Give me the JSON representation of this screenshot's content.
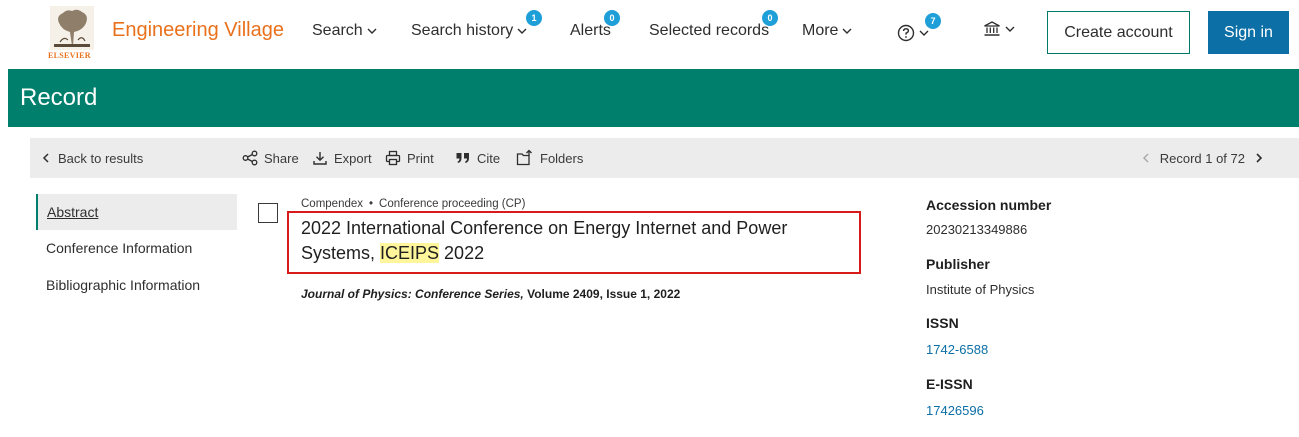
{
  "brand": {
    "logo_text": "ELSEVIER",
    "name": "Engineering Village"
  },
  "nav": {
    "search": "Search",
    "search_history": "Search history",
    "search_history_count": "1",
    "alerts": "Alerts",
    "alerts_count": "0",
    "selected_records": "Selected records",
    "selected_records_count": "0",
    "more": "More",
    "help_count": "7",
    "create_account": "Create account",
    "sign_in": "Sign in"
  },
  "header": {
    "title": "Record"
  },
  "toolbar": {
    "back": "Back to results",
    "share": "Share",
    "export": "Export",
    "print": "Print",
    "cite": "Cite",
    "folders": "Folders",
    "record_position": "Record 1 of 72"
  },
  "leftnav": {
    "items": [
      "Abstract",
      "Conference Information",
      "Bibliographic Information"
    ],
    "active": "Abstract"
  },
  "record": {
    "database": "Compendex",
    "doc_type": "Conference proceeding (CP)",
    "title_before": "2022 International Conference on Energy Internet and Power Systems, ",
    "title_highlight": "ICEIPS",
    "title_after": " 2022",
    "journal": "Journal of Physics: Conference Series,",
    "volume_issue": "Volume 2409, Issue 1, 2022"
  },
  "details": {
    "accession_label": "Accession number",
    "accession_value": "20230213349886",
    "publisher_label": "Publisher",
    "publisher_value": "Institute of Physics",
    "issn_label": "ISSN",
    "issn_value": "1742-6588",
    "eissn_label": "E-ISSN",
    "eissn_value": "17426596"
  },
  "colors": {
    "brand_orange": "#e9711c",
    "header_green": "#007f6d",
    "badge_blue": "#1e9fd8",
    "signin_blue": "#0c6fa6",
    "highlight_yellow": "#fff59a",
    "annotation_red": "#d71b1b"
  }
}
